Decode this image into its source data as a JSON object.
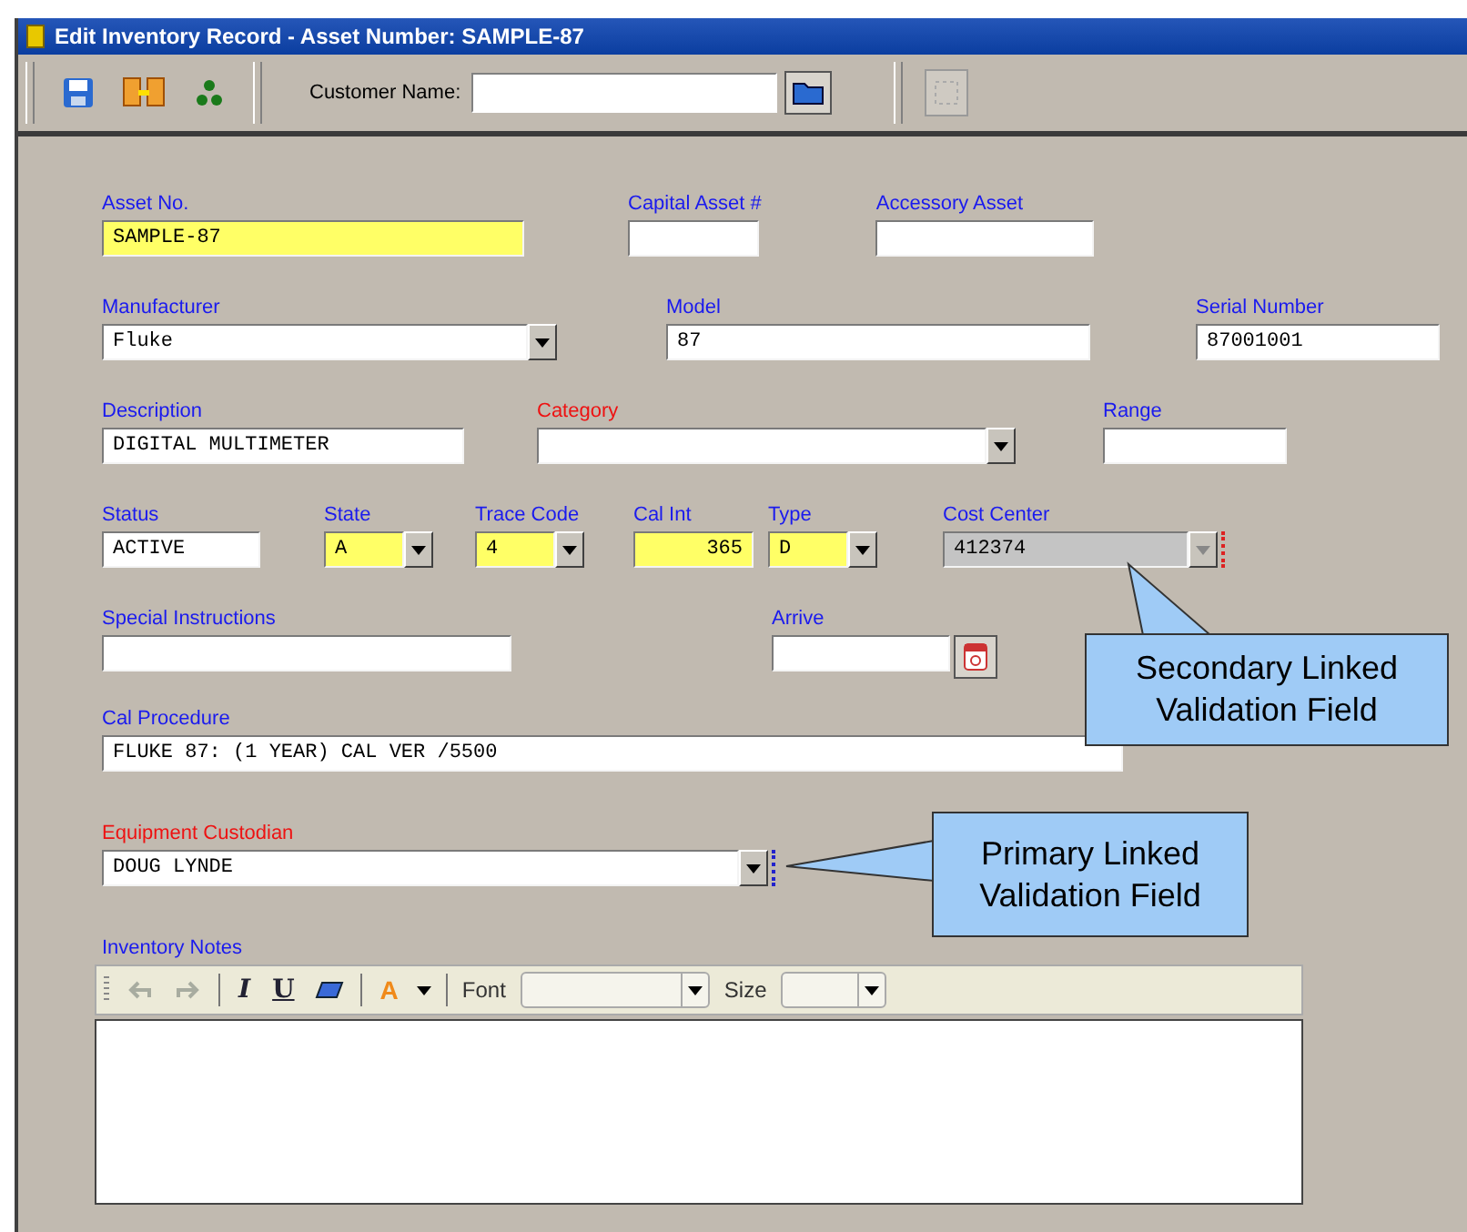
{
  "window": {
    "title": "Edit Inventory Record - Asset Number: SAMPLE-87"
  },
  "toolbar": {
    "customer_label": "Customer Name:",
    "frame_tool_disabled": true
  },
  "form_rows": [
    [
      {
        "label": "Asset No.",
        "value": "SAMPLE-87",
        "kind": "text",
        "highlighted": true
      },
      {
        "label": "Capital Asset #",
        "kind": "text"
      },
      {
        "label": "Accessory Asset",
        "kind": "text"
      }
    ],
    [
      {
        "label": "Manufacturer",
        "value": "Fluke",
        "kind": "combo"
      },
      {
        "label": "Model",
        "value": "87",
        "kind": "text"
      },
      {
        "label": "Serial Number",
        "value": "87001001",
        "kind": "text"
      }
    ],
    [
      {
        "label": "Description",
        "value": "DIGITAL MULTIMETER",
        "kind": "text"
      },
      {
        "label": "Category",
        "kind": "combo",
        "required": true
      },
      {
        "label": "Range",
        "kind": "text"
      }
    ],
    [
      {
        "label": "Status",
        "value": "ACTIVE",
        "kind": "text"
      },
      {
        "label": "State",
        "value": "A",
        "kind": "combo",
        "highlighted": true
      },
      {
        "label": "Trace Code",
        "value": "4",
        "kind": "combo",
        "highlighted": true
      },
      {
        "label": "Cal Int",
        "value": "365",
        "kind": "number",
        "highlighted": true
      },
      {
        "label": "Type",
        "value": "D",
        "kind": "combo",
        "highlighted": true
      },
      {
        "label": "Cost Center",
        "value": "412374",
        "kind": "combo",
        "disabled": true,
        "color": "#dd2222"
      }
    ],
    [
      {
        "label": "Special Instructions",
        "kind": "text"
      },
      {
        "label": "Arrive",
        "kind": "date"
      }
    ],
    [
      {
        "label": "Cal Procedure",
        "value": "FLUKE 87: (1 YEAR) CAL VER /5500",
        "kind": "text"
      }
    ],
    [
      {
        "label": "Equipment Custodian",
        "value": "DOUG LYNDE",
        "kind": "combo",
        "required": true,
        "color": "#2222cc"
      }
    ]
  ],
  "notes": {
    "label": "Inventory Notes",
    "undo_disabled": true,
    "redo_disabled": true,
    "italic": "I",
    "underline": "U",
    "font_color": "A",
    "font_label": "Font",
    "size_label": "Size"
  },
  "callouts": [
    {
      "text": "Secondary Linked Validation Field"
    },
    {
      "text": "Primary Linked Validation Field"
    }
  ]
}
